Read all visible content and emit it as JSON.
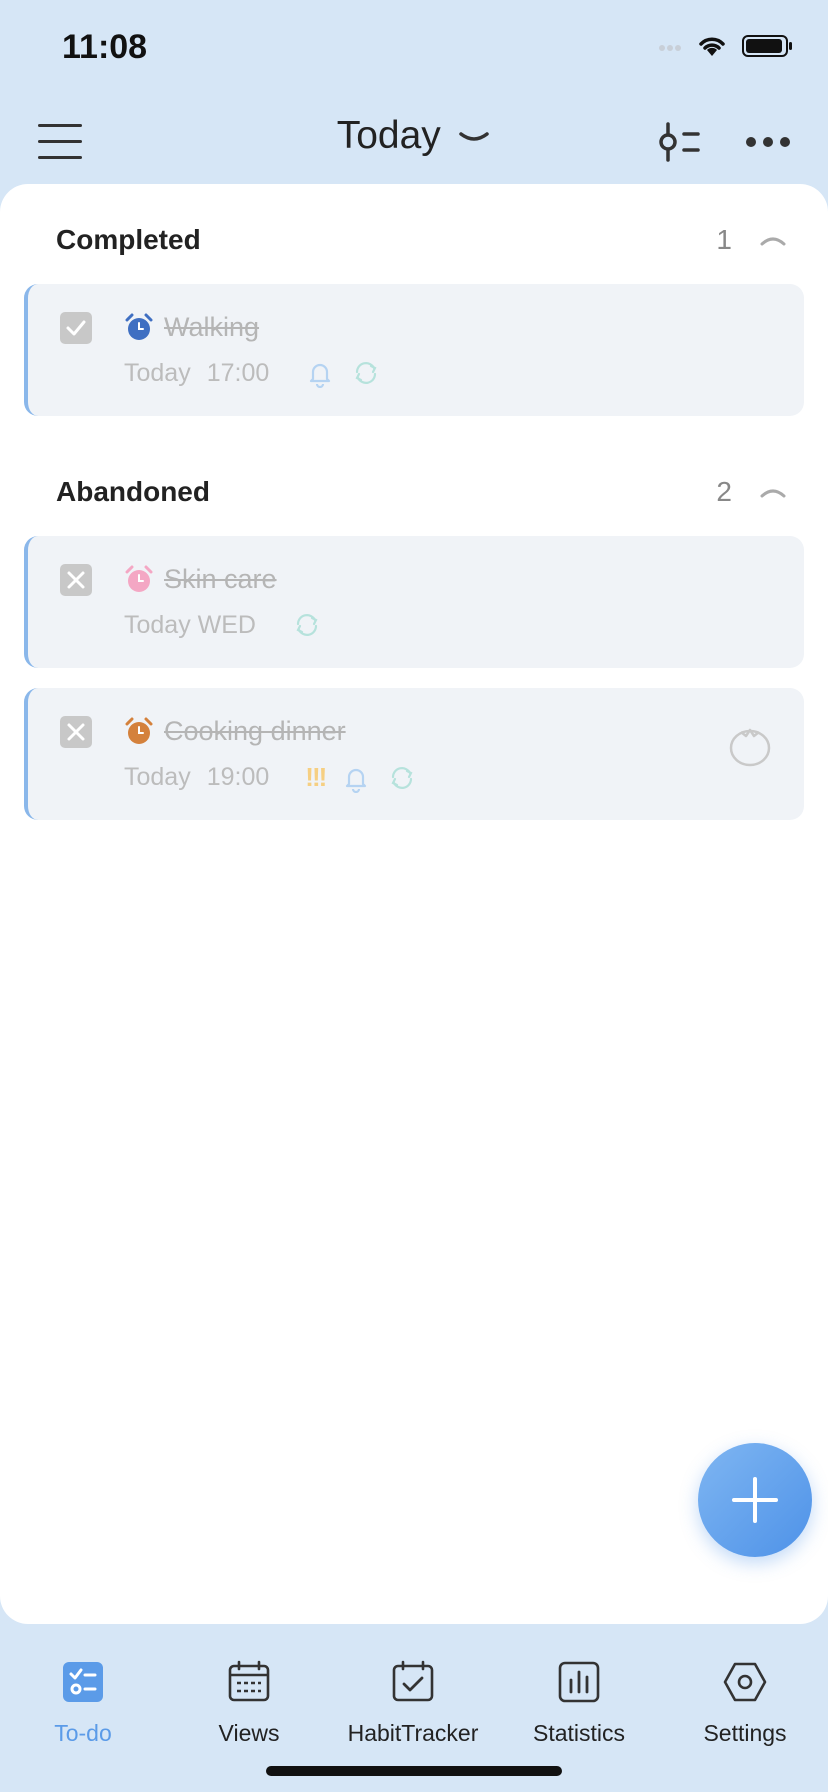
{
  "status_bar": {
    "time": "11:08"
  },
  "header": {
    "title": "Today"
  },
  "sections": {
    "completed": {
      "title": "Completed",
      "count": "1",
      "tasks": [
        {
          "title": "Walking",
          "date": "Today",
          "time": "17:00",
          "alarm_color": "#3f6fc2"
        }
      ]
    },
    "abandoned": {
      "title": "Abandoned",
      "count": "2",
      "tasks": [
        {
          "title": "Skin care",
          "date": "Today WED",
          "time": "",
          "alarm_color": "#f4a7c4"
        },
        {
          "title": "Cooking dinner",
          "date": "Today",
          "time": "19:00",
          "priority": "!!!",
          "alarm_color": "#d4813c"
        }
      ]
    }
  },
  "tabs": [
    {
      "label": "To-do",
      "icon": "todo-icon",
      "active": true
    },
    {
      "label": "Views",
      "icon": "calendar-icon"
    },
    {
      "label": "HabitTracker",
      "icon": "calendar-check-icon"
    },
    {
      "label": "Statistics",
      "icon": "bar-chart-icon"
    },
    {
      "label": "Settings",
      "icon": "hexagon-settings-icon"
    }
  ],
  "colors": {
    "accent": "#5b9be8",
    "background": "#d6e6f6",
    "card": "#f0f3f7"
  }
}
